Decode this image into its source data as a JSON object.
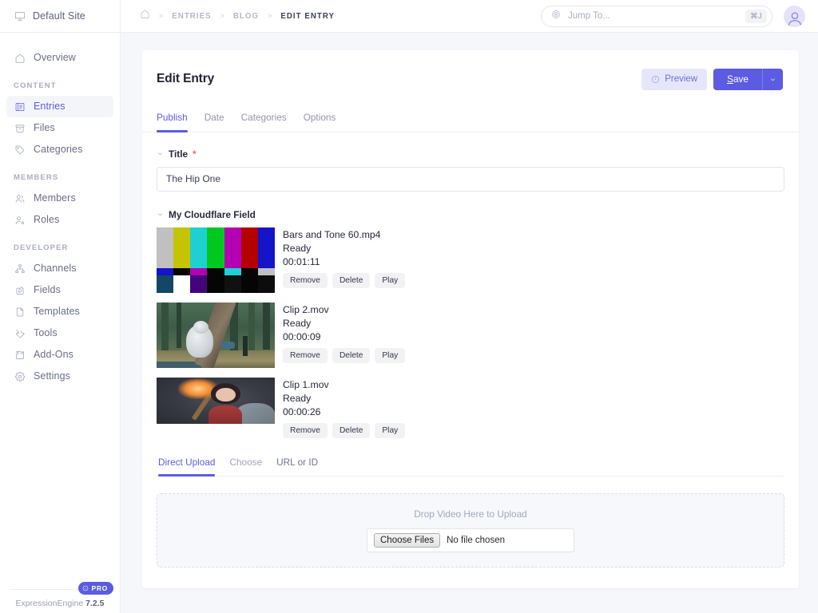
{
  "sidebar": {
    "site": {
      "label": "Default Site",
      "icon": "monitor-icon"
    },
    "top_items": [
      {
        "label": "Overview",
        "icon": "home-icon",
        "active": false
      }
    ],
    "sections": [
      {
        "label": "CONTENT",
        "items": [
          {
            "label": "Entries",
            "icon": "entries-icon",
            "active": true
          },
          {
            "label": "Files",
            "icon": "files-icon",
            "active": false
          },
          {
            "label": "Categories",
            "icon": "tag-icon",
            "active": false
          }
        ]
      },
      {
        "label": "MEMBERS",
        "items": [
          {
            "label": "Members",
            "icon": "members-icon",
            "active": false
          },
          {
            "label": "Roles",
            "icon": "roles-icon",
            "active": false
          }
        ]
      },
      {
        "label": "DEVELOPER",
        "items": [
          {
            "label": "Channels",
            "icon": "channels-icon",
            "active": false
          },
          {
            "label": "Fields",
            "icon": "fields-icon",
            "active": false
          },
          {
            "label": "Templates",
            "icon": "templates-icon",
            "active": false
          },
          {
            "label": "Tools",
            "icon": "tools-icon",
            "active": false
          },
          {
            "label": "Add-Ons",
            "icon": "puzzle-icon",
            "active": false
          },
          {
            "label": "Settings",
            "icon": "gear-icon",
            "active": false
          }
        ]
      }
    ],
    "footer": {
      "pro_badge": "PRO",
      "product": "ExpressionEngine",
      "version": "7.2.5"
    }
  },
  "topbar": {
    "breadcrumb": [
      {
        "label": "ENTRIES",
        "current": false
      },
      {
        "label": "BLOG",
        "current": false
      },
      {
        "label": "EDIT ENTRY",
        "current": true
      }
    ],
    "separator": ">",
    "search": {
      "placeholder": "Jump To...",
      "value": "",
      "shortcut": "⌘J"
    }
  },
  "panel": {
    "title": "Edit Entry",
    "preview_label": "Preview",
    "save_label": "Save",
    "save_accesskey": "S",
    "tabs": [
      {
        "label": "Publish",
        "active": true
      },
      {
        "label": "Date",
        "active": false
      },
      {
        "label": "Categories",
        "active": false
      },
      {
        "label": "Options",
        "active": false
      }
    ]
  },
  "fields": {
    "title": {
      "label": "Title",
      "required": "*",
      "value": "The Hip One"
    },
    "cloudflare": {
      "label": "My Cloudflare Field"
    }
  },
  "videos": [
    {
      "name": "Bars and Tone 60.mp4",
      "status": "Ready",
      "duration": "00:01:11",
      "thumb": "smpte-bars",
      "buttons": [
        "Remove",
        "Delete",
        "Play"
      ]
    },
    {
      "name": "Clip 2.mov",
      "status": "Ready",
      "duration": "00:00:09",
      "thumb": "forest-scene",
      "buttons": [
        "Remove",
        "Delete",
        "Play"
      ]
    },
    {
      "name": "Clip 1.mov",
      "status": "Ready",
      "duration": "00:00:26",
      "thumb": "girl-scene",
      "buttons": [
        "Remove",
        "Delete",
        "Play"
      ]
    }
  ],
  "upload": {
    "tabs": [
      {
        "label": "Direct Upload",
        "active": true
      },
      {
        "label": "Choose",
        "active": false
      },
      {
        "label": "URL or ID",
        "active": false
      }
    ],
    "drop_text": "Drop Video Here to Upload",
    "choose_files_label": "Choose Files",
    "no_file_label": "No file chosen"
  },
  "colors": {
    "accent": "#5b5ce2",
    "accent_soft": "#e6e6fb",
    "page_bg": "#f6f7fa",
    "text": "#25283a",
    "muted": "#9197b0",
    "required": "#f06a6a"
  },
  "smpte_bars": {
    "top": [
      "#c0c0c0",
      "#c4c400",
      "#1fd0d0",
      "#00c820",
      "#b200b2",
      "#b50000",
      "#1414c8"
    ],
    "mid": [
      "#1414c8",
      "#050505",
      "#b200b2",
      "#050505",
      "#1fd0d0",
      "#050505",
      "#c0c0c0"
    ],
    "bottom": [
      "#134766",
      "#ffffff",
      "#43057a",
      "#050505",
      "#0c0c0c",
      "#050505",
      "#0c0c0c"
    ]
  }
}
